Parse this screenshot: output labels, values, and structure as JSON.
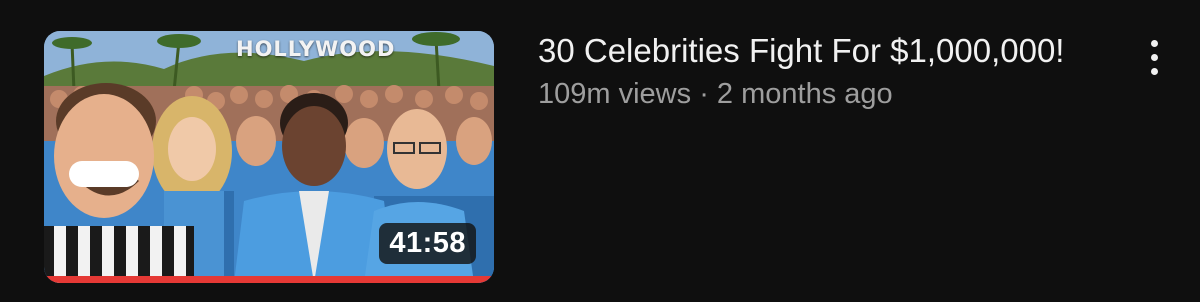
{
  "video": {
    "title": "30 Celebrities Fight For $1,000,000!",
    "views": "109m views",
    "separator": "·",
    "age": "2 months ago",
    "thumbnail_sign": "HOLLYWOOD",
    "duration": "41:58",
    "watch_progress": 1.0,
    "progress_color": "#e53935",
    "menu_icon": "more-vert-icon"
  }
}
